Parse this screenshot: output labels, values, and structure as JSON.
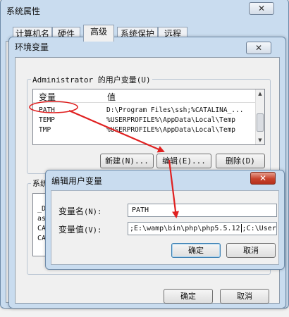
{
  "system_properties": {
    "title": "系统属性",
    "tabs": [
      {
        "label": "计算机名"
      },
      {
        "label": "硬件"
      },
      {
        "label": "高级"
      },
      {
        "label": "系统保护"
      },
      {
        "label": "远程"
      }
    ]
  },
  "env_vars": {
    "title": "环境变量",
    "user_group_label": "Administrator 的用户变量(U)",
    "columns": {
      "name": "变量",
      "value": "值"
    },
    "user_vars": [
      {
        "name": "PATH",
        "value": "D:\\Program Files\\ssh;%CATALINA_..."
      },
      {
        "name": "TEMP",
        "value": "%USERPROFILE%\\AppData\\Local\\Temp"
      },
      {
        "name": "TMP",
        "value": "%USERPROFILE%\\AppData\\Local\\Temp"
      }
    ],
    "buttons": {
      "new": "新建(N)...",
      "edit": "编辑(E)...",
      "delete": "删除(D)"
    },
    "system_group_label": "系统",
    "system_vars_partial": [
      "_D",
      "as",
      "CA",
      "CA"
    ],
    "ok": "确定",
    "cancel": "取消"
  },
  "edit_dialog": {
    "title": "编辑用户变量",
    "name_label": "变量名",
    "name_shortcut": "(N):",
    "value_label": "变量值",
    "value_shortcut": "(V):",
    "name_value": "PATH",
    "value_before_caret": ";E:\\wamp\\bin\\php\\php5.5.12",
    "value_after_caret": ";C:\\Users",
    "ok": "确定",
    "cancel": "取消"
  }
}
